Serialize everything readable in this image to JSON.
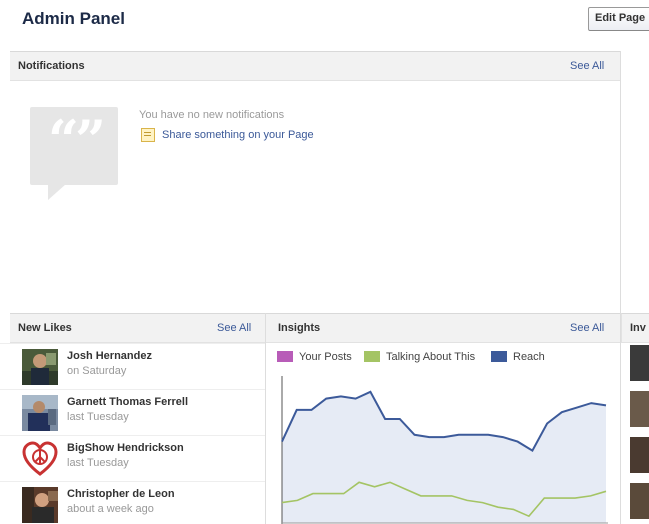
{
  "header": {
    "title": "Admin Panel",
    "edit_button": "Edit Page"
  },
  "notifications": {
    "title": "Notifications",
    "see_all": "See All",
    "empty_text": "You have no new notifications",
    "share_link": "Share something on your Page",
    "icon": "speech-bubble-quotes-icon"
  },
  "new_likes": {
    "title": "New Likes",
    "see_all": "See All",
    "items": [
      {
        "name": "Josh Hernandez",
        "time": "on Saturday"
      },
      {
        "name": "Garnett Thomas Ferrell",
        "time": "last Tuesday"
      },
      {
        "name": "BigShow Hendrickson",
        "time": "last Tuesday"
      },
      {
        "name": "Christopher de Leon",
        "time": "about a week ago"
      }
    ]
  },
  "insights": {
    "title": "Insights",
    "see_all": "See All"
  },
  "invite": {
    "title": "Inv"
  },
  "colors": {
    "title": "#1c2a47",
    "link": "#3b5998",
    "your_posts": "#b85cb8",
    "talking_about": "#a4c464",
    "reach": "#3c5a9a",
    "reach_fill": "#e6ebf5"
  },
  "chart_data": {
    "type": "line",
    "legend_position": "top-left",
    "series": [
      {
        "name": "Your Posts",
        "color": "#b85cb8",
        "values": []
      },
      {
        "name": "Talking About This",
        "color": "#a4c464",
        "values": [
          0.9,
          1.0,
          1.3,
          1.3,
          1.3,
          1.8,
          1.6,
          1.8,
          1.5,
          1.2,
          1.2,
          1.2,
          1.0,
          0.9,
          0.7,
          0.6,
          0.3,
          1.1,
          1.1,
          1.1,
          1.2,
          1.4
        ]
      },
      {
        "name": "Reach",
        "color": "#3c5a9a",
        "values": [
          3.6,
          5.0,
          5.0,
          5.5,
          5.6,
          5.5,
          5.8,
          4.6,
          4.6,
          3.9,
          3.8,
          3.8,
          3.9,
          3.9,
          3.9,
          3.8,
          3.6,
          3.2,
          4.4,
          4.9,
          5.1,
          5.3,
          5.2
        ]
      }
    ],
    "ylim": [
      0,
      6.5
    ]
  }
}
